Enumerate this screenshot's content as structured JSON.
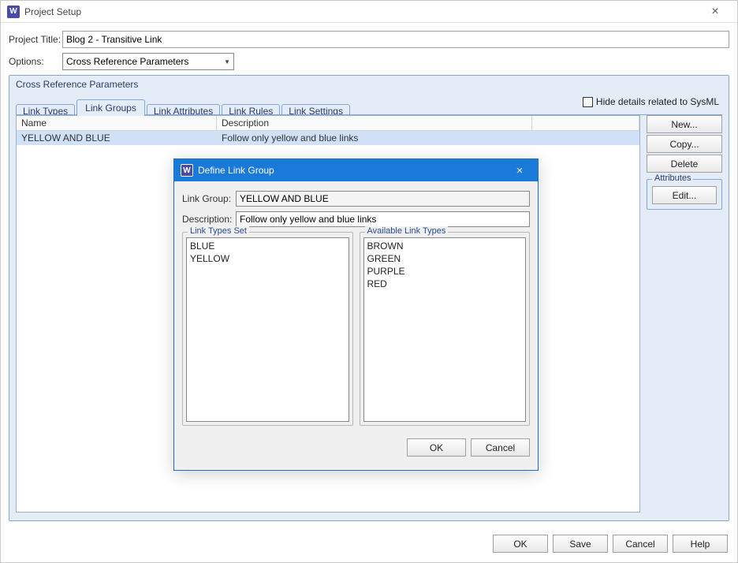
{
  "window": {
    "title": "Project Setup",
    "close_glyph": "×"
  },
  "labels": {
    "project_title": "Project Title:",
    "options": "Options:"
  },
  "project_title_value": "Blog 2 - Transitive Link",
  "options_value": "Cross Reference Parameters",
  "panel": {
    "title": "Cross Reference Parameters"
  },
  "tabs": {
    "link_types": "Link Types",
    "link_groups": "Link Groups",
    "link_attributes": "Link Attributes",
    "link_rules": "Link Rules",
    "link_settings": "Link Settings"
  },
  "sysml_label": "Hide details related to SysML",
  "table": {
    "headers": {
      "name": "Name",
      "description": "Description"
    },
    "rows": [
      {
        "name": "YELLOW AND BLUE",
        "description": "Follow only yellow and blue links"
      }
    ]
  },
  "side_buttons": {
    "new": "New...",
    "copy": "Copy...",
    "delete": "Delete",
    "attributes_legend": "Attributes",
    "edit": "Edit..."
  },
  "footer": {
    "ok": "OK",
    "save": "Save",
    "cancel": "Cancel",
    "help": "Help"
  },
  "dialog": {
    "title": "Define Link Group",
    "labels": {
      "link_group": "Link Group:",
      "description": "Description:",
      "set_legend": "Link Types Set",
      "available_legend": "Available Link Types"
    },
    "link_group_value": "YELLOW AND BLUE",
    "description_value": "Follow only yellow and blue links",
    "set_items": [
      "BLUE",
      "YELLOW"
    ],
    "available_items": [
      "BROWN",
      "GREEN",
      "PURPLE",
      "RED"
    ],
    "buttons": {
      "ok": "OK",
      "cancel": "Cancel"
    }
  }
}
